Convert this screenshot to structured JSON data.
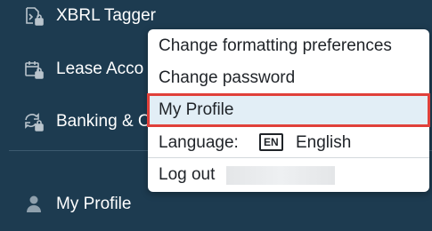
{
  "sidebar": {
    "items": [
      {
        "label": "XBRL Tagger",
        "icon": "tag-document-lock-icon"
      },
      {
        "label": "Lease Acco",
        "icon": "calendar-lock-icon"
      },
      {
        "label": "Banking & C",
        "icon": "exchange-lock-icon"
      },
      {
        "label": "My Profile",
        "icon": "person-icon"
      }
    ]
  },
  "menu": {
    "change_formatting": "Change formatting preferences",
    "change_password": "Change password",
    "my_profile": "My Profile",
    "language_label": "Language:",
    "language_code": "EN",
    "language_name": "English",
    "logout": "Log out"
  },
  "colors": {
    "sidebar_bg": "#1d3b50",
    "highlight_bg": "#e2eef6",
    "highlight_border": "#e0403a"
  }
}
